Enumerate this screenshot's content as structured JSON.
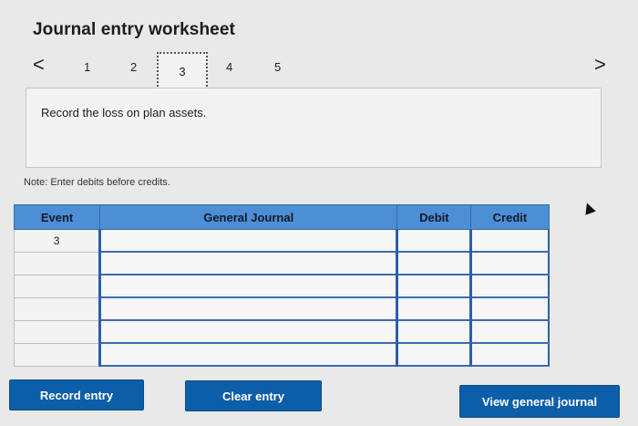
{
  "header": {
    "title": "Journal entry worksheet"
  },
  "nav": {
    "pages": [
      "1",
      "2",
      "3",
      "4",
      "5"
    ],
    "active_page": "3",
    "prev_label": "<",
    "next_label": ">"
  },
  "prompt": {
    "text": "Record the loss on plan assets."
  },
  "note": "Note: Enter debits before credits.",
  "table": {
    "columns": [
      "Event",
      "General Journal",
      "Debit",
      "Credit"
    ],
    "rows": [
      {
        "event": "3",
        "journal": "",
        "debit": "",
        "credit": ""
      },
      {
        "event": "",
        "journal": "",
        "debit": "",
        "credit": ""
      },
      {
        "event": "",
        "journal": "",
        "debit": "",
        "credit": ""
      },
      {
        "event": "",
        "journal": "",
        "debit": "",
        "credit": ""
      },
      {
        "event": "",
        "journal": "",
        "debit": "",
        "credit": ""
      },
      {
        "event": "",
        "journal": "",
        "debit": "",
        "credit": ""
      }
    ]
  },
  "buttons": {
    "record_entry": "Record entry",
    "clear_entry": "Clear entry",
    "view_general_journal": "View general journal"
  },
  "colors": {
    "header_blue": "#4d8fd4",
    "button_blue": "#0d5ea8"
  }
}
